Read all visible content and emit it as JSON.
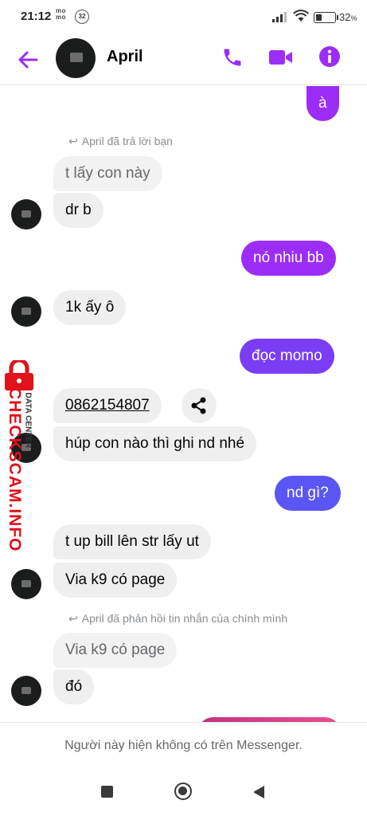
{
  "status_bar": {
    "time": "21:12",
    "app_badge": "mo mo",
    "notification_count": "32",
    "battery_percent": "32",
    "battery_percent_suffix": "%"
  },
  "header": {
    "contact_name": "April",
    "accent_color": "#9b2df7"
  },
  "messages": [
    {
      "side": "out",
      "text": "à"
    },
    {
      "type": "reply_note",
      "text": "April đã trả lời bạn"
    },
    {
      "side": "quoted",
      "text": "t lấy con này"
    },
    {
      "side": "in",
      "text": "dr b"
    },
    {
      "side": "out",
      "text": "nó nhiu bb"
    },
    {
      "side": "in",
      "text": "1k ấy ô"
    },
    {
      "side": "out",
      "text": "đọc momo"
    },
    {
      "side": "in",
      "text": "0862154807"
    },
    {
      "side": "in",
      "text": "húp con nào thì ghi nd nhé"
    },
    {
      "side": "out",
      "text": "nd gì?"
    },
    {
      "side": "in",
      "text": "t up bill lên str lấy ut"
    },
    {
      "side": "in",
      "text": "Via k9 có page"
    },
    {
      "type": "reply_note",
      "text": "April đã phản hồi tin nhắn của chính mình"
    },
    {
      "side": "quoted",
      "text": "Via k9 có page"
    },
    {
      "side": "in",
      "text": "đó"
    }
  ],
  "watermark": {
    "brand": "CHECKSCAM.INFO",
    "sub": "DATA CENTER"
  },
  "notice": "Người này hiện không có trên Messenger.",
  "icons": [
    "back-arrow-icon",
    "phone-icon",
    "video-camera-icon",
    "info-icon",
    "reply-arrow-icon",
    "share-icon",
    "lock-icon"
  ]
}
